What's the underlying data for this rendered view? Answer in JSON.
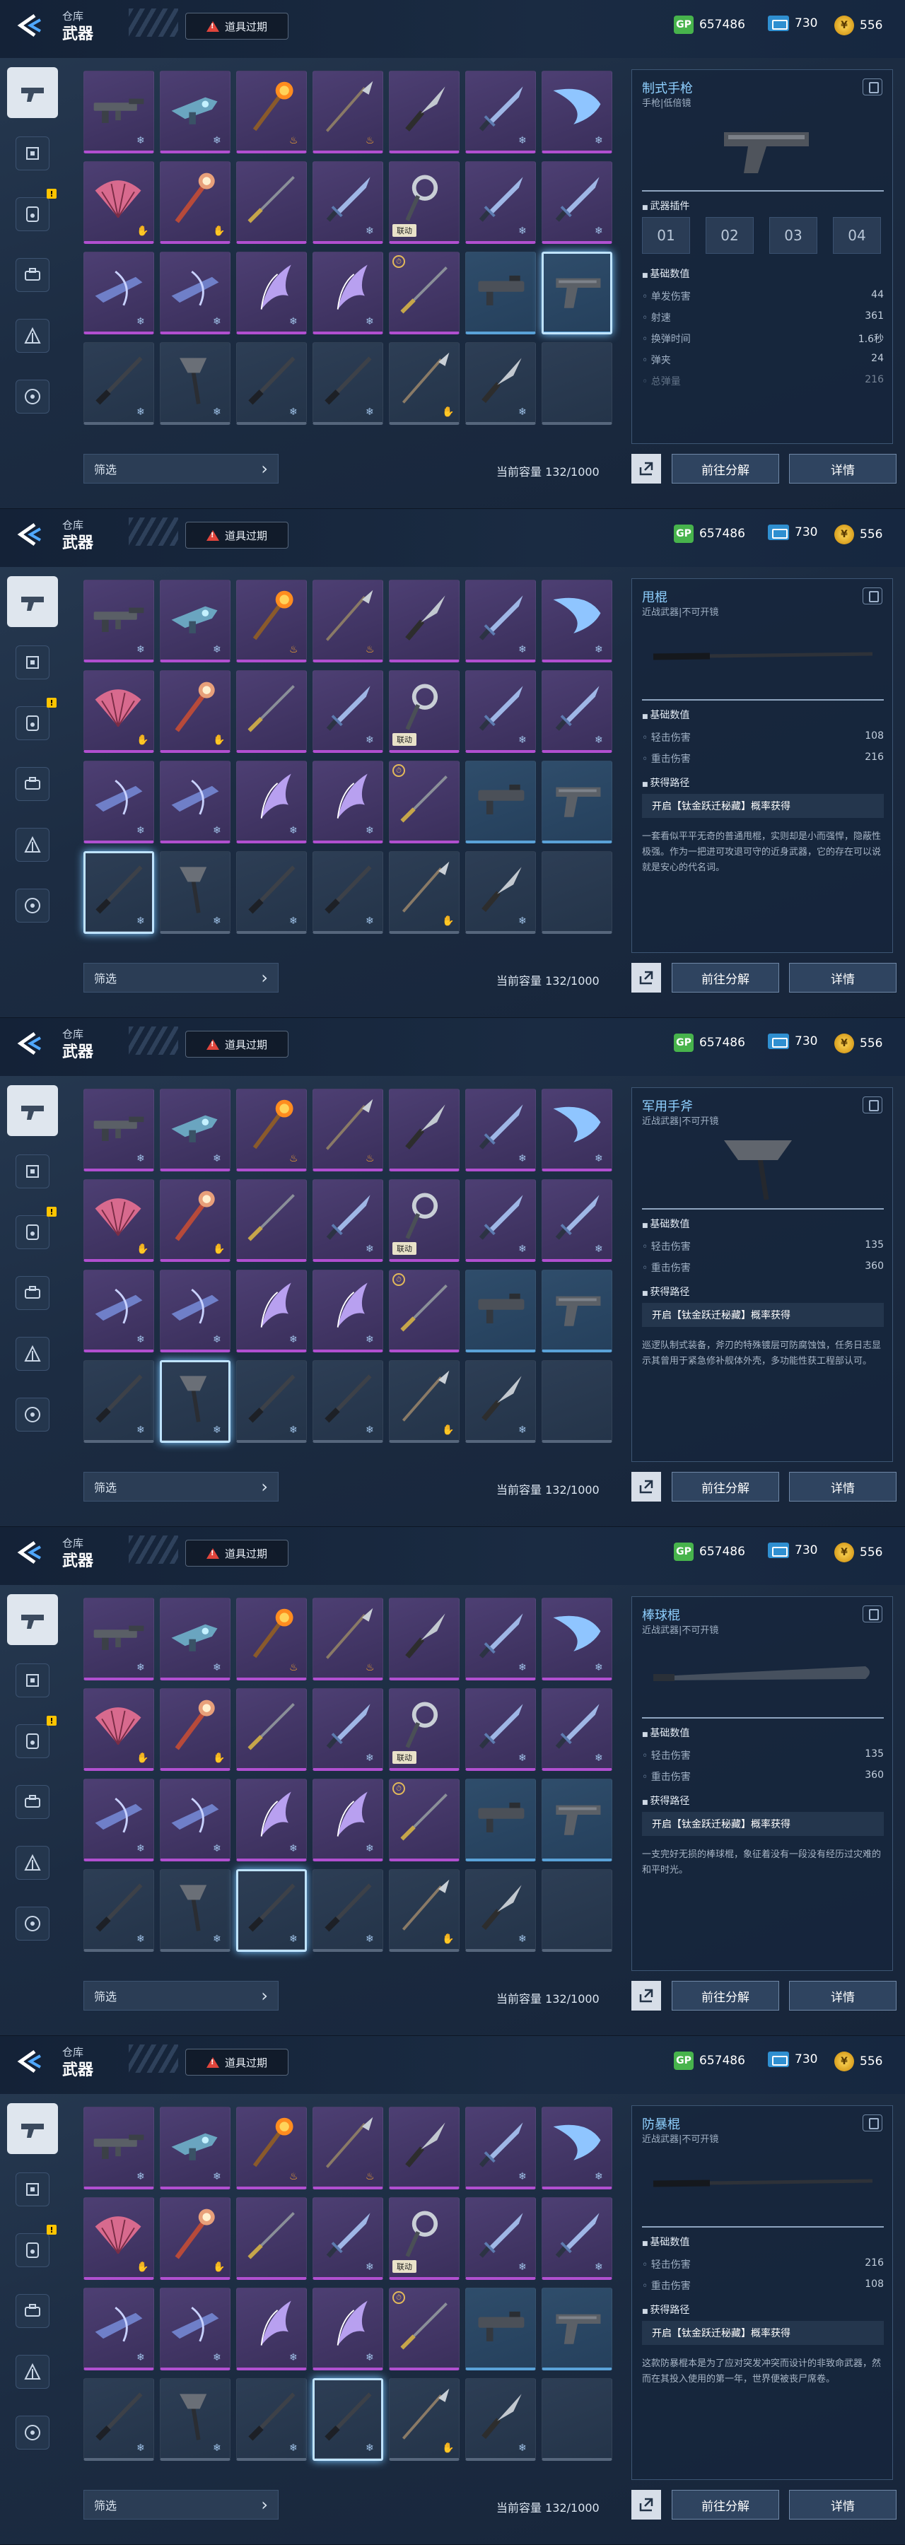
{
  "header": {
    "breadcrumb": "仓库",
    "title": "武器",
    "expire_label": "道具过期"
  },
  "currency": {
    "gp_icon": "GP",
    "gp": "657486",
    "ticket": "730",
    "coin": "556"
  },
  "sidebar": [
    {
      "icon": "pistol-icon",
      "active": true,
      "badge": ""
    },
    {
      "icon": "chip-icon",
      "active": false,
      "badge": ""
    },
    {
      "icon": "device-icon",
      "active": false,
      "badge": "!"
    },
    {
      "icon": "gear-case-icon",
      "active": false,
      "badge": ""
    },
    {
      "icon": "vehicle-icon",
      "active": false,
      "badge": ""
    },
    {
      "icon": "target-icon",
      "active": false,
      "badge": ""
    }
  ],
  "grid": [
    {
      "weapon": "rifle",
      "rarity": "purple",
      "icon": "frost"
    },
    {
      "weapon": "blaster",
      "rarity": "purple",
      "icon": "frost"
    },
    {
      "weapon": "flame-staff",
      "rarity": "purple",
      "icon": "fire"
    },
    {
      "weapon": "spear",
      "rarity": "purple",
      "icon": "fire"
    },
    {
      "weapon": "knife",
      "rarity": "purple",
      "icon": ""
    },
    {
      "weapon": "sword",
      "rarity": "purple",
      "icon": "frost"
    },
    {
      "weapon": "blade",
      "rarity": "purple",
      "icon": "frost"
    },
    {
      "weapon": "fan",
      "rarity": "purple",
      "icon": "hand"
    },
    {
      "weapon": "staff",
      "rarity": "purple",
      "icon": "hand"
    },
    {
      "weapon": "rod",
      "rarity": "purple",
      "icon": ""
    },
    {
      "weapon": "sword",
      "rarity": "purple",
      "icon": "frost"
    },
    {
      "weapon": "chakram",
      "rarity": "purple",
      "icon": "",
      "tag": "联动"
    },
    {
      "weapon": "sword",
      "rarity": "purple",
      "icon": "frost"
    },
    {
      "weapon": "sword",
      "rarity": "purple",
      "icon": "frost"
    },
    {
      "weapon": "crossbow",
      "rarity": "purple",
      "icon": "frost"
    },
    {
      "weapon": "crossbow",
      "rarity": "purple",
      "icon": "frost"
    },
    {
      "weapon": "wing-blade",
      "rarity": "purple",
      "icon": "frost"
    },
    {
      "weapon": "wing-blade",
      "rarity": "purple",
      "icon": "frost"
    },
    {
      "weapon": "rod",
      "rarity": "purple",
      "icon": "",
      "clock": true
    },
    {
      "weapon": "launcher",
      "rarity": "blue",
      "icon": ""
    },
    {
      "weapon": "pistol",
      "rarity": "blue",
      "icon": ""
    },
    {
      "weapon": "baton",
      "rarity": "gray",
      "icon": "frost"
    },
    {
      "weapon": "axe",
      "rarity": "gray",
      "icon": "frost"
    },
    {
      "weapon": "baton",
      "rarity": "gray",
      "icon": "frost"
    },
    {
      "weapon": "baton",
      "rarity": "gray",
      "icon": "frost"
    },
    {
      "weapon": "spear",
      "rarity": "gray",
      "icon": "hand"
    },
    {
      "weapon": "knife",
      "rarity": "gray",
      "icon": "frost"
    },
    {
      "weapon": "empty",
      "rarity": "gray",
      "icon": ""
    }
  ],
  "tag_text": "联动",
  "frost_icon": "snowflake-icon",
  "filter_label": "筛选",
  "capacity_label": "当前容量 132/1000",
  "buttons": {
    "decompose": "前往分解",
    "detail": "详情"
  },
  "screens": [
    {
      "selected": 20,
      "item": {
        "name": "制式手枪",
        "subtitle": "手枪|低倍镜",
        "kind": "pistol"
      },
      "plugins_label": "武器插件",
      "plugins": [
        "01",
        "02",
        "03",
        "04"
      ],
      "base_label": "基础数值",
      "stats": [
        [
          "单发伤害",
          "44"
        ],
        [
          "射速",
          "361"
        ],
        [
          "换弹时间",
          "1.6秒"
        ],
        [
          "弹夹",
          "24"
        ],
        [
          "总弹量",
          "216"
        ]
      ],
      "route_label": "",
      "route": "",
      "desc": ""
    },
    {
      "selected": 21,
      "item": {
        "name": "甩棍",
        "subtitle": "近战武器|不可开镜",
        "kind": "baton"
      },
      "plugins_label": "",
      "plugins": [],
      "base_label": "基础数值",
      "stats": [
        [
          "轻击伤害",
          "108"
        ],
        [
          "重击伤害",
          "216"
        ]
      ],
      "route_label": "获得路径",
      "route": "开启【钛金跃迁秘藏】概率获得",
      "desc": "一套看似平平无奇的普通甩棍，实则却是小而强悍，隐蔽性极强。作为一把进可攻退可守的近身武器，它的存在可以说就是安心的代名词。"
    },
    {
      "selected": 22,
      "item": {
        "name": "军用手斧",
        "subtitle": "近战武器|不可开镜",
        "kind": "axe"
      },
      "plugins_label": "",
      "plugins": [],
      "base_label": "基础数值",
      "stats": [
        [
          "轻击伤害",
          "135"
        ],
        [
          "重击伤害",
          "360"
        ]
      ],
      "route_label": "获得路径",
      "route": "开启【钛金跃迁秘藏】概率获得",
      "desc": "巡逻队制式装备，斧刃的特殊镀层可防腐蚀蚀，任务日志显示其曾用于紧急修补舰体外壳，多功能性获工程部认可。"
    },
    {
      "selected": 23,
      "item": {
        "name": "棒球棍",
        "subtitle": "近战武器|不可开镜",
        "kind": "bat"
      },
      "plugins_label": "",
      "plugins": [],
      "base_label": "基础数值",
      "stats": [
        [
          "轻击伤害",
          "135"
        ],
        [
          "重击伤害",
          "360"
        ]
      ],
      "route_label": "获得路径",
      "route": "开启【钛金跃迁秘藏】概率获得",
      "desc": "一支完好无损的棒球棍，象征着没有一段没有经历过灾难的和平时光。"
    },
    {
      "selected": 24,
      "item": {
        "name": "防暴棍",
        "subtitle": "近战武器|不可开镜",
        "kind": "baton"
      },
      "plugins_label": "",
      "plugins": [],
      "base_label": "基础数值",
      "stats": [
        [
          "轻击伤害",
          "216"
        ],
        [
          "重击伤害",
          "108"
        ]
      ],
      "route_label": "获得路径",
      "route": "开启【钛金跃迁秘藏】概率获得",
      "desc": "这款防暴棍本是为了应对突发冲突而设计的非致命武器，然而在其投入使用的第一年，世界便被丧尸席卷。"
    }
  ]
}
